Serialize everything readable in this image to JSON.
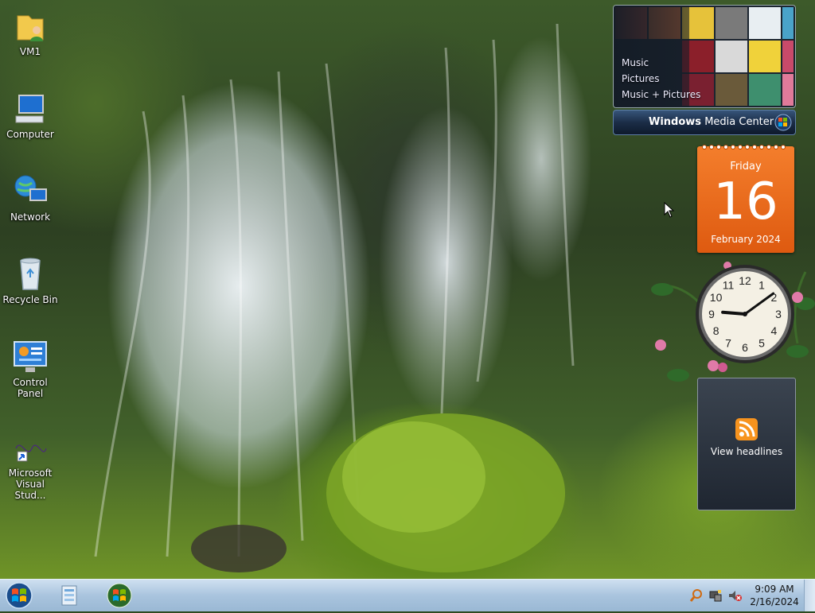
{
  "desktop_icons": [
    {
      "label": "VM1",
      "icon": "user-folder-icon"
    },
    {
      "label": "Computer",
      "icon": "computer-icon"
    },
    {
      "label": "Network",
      "icon": "network-icon"
    },
    {
      "label": "Recycle Bin",
      "icon": "recycle-bin-icon"
    },
    {
      "label": "Control Panel",
      "icon": "control-panel-icon"
    },
    {
      "label": "Microsoft Visual Stud...",
      "icon": "visual-studio-icon"
    }
  ],
  "media_center": {
    "menu": [
      "Music",
      "Pictures",
      "Music + Pictures"
    ],
    "brand_bold": "Windows",
    "brand_light": "Media Center"
  },
  "calendar": {
    "weekday": "Friday",
    "day": "16",
    "month_year": "February 2024",
    "color": "#e8661a"
  },
  "clock": {
    "numerals": [
      "12",
      "1",
      "2",
      "3",
      "4",
      "5",
      "6",
      "7",
      "8",
      "9",
      "10",
      "11"
    ],
    "time": "9:09"
  },
  "feed": {
    "label": "View headlines",
    "icon": "rss-icon",
    "accent": "#f7931e"
  },
  "taskbar": {
    "start": "start-orb-icon",
    "pinned": [
      "file-explorer-icon",
      "windows-orb-icon"
    ],
    "tray_icons": [
      "search-icon",
      "network-tray-icon",
      "volume-muted-icon"
    ],
    "time": "9:09 AM",
    "date": "2/16/2024",
    "color": "#b8cfe6"
  }
}
